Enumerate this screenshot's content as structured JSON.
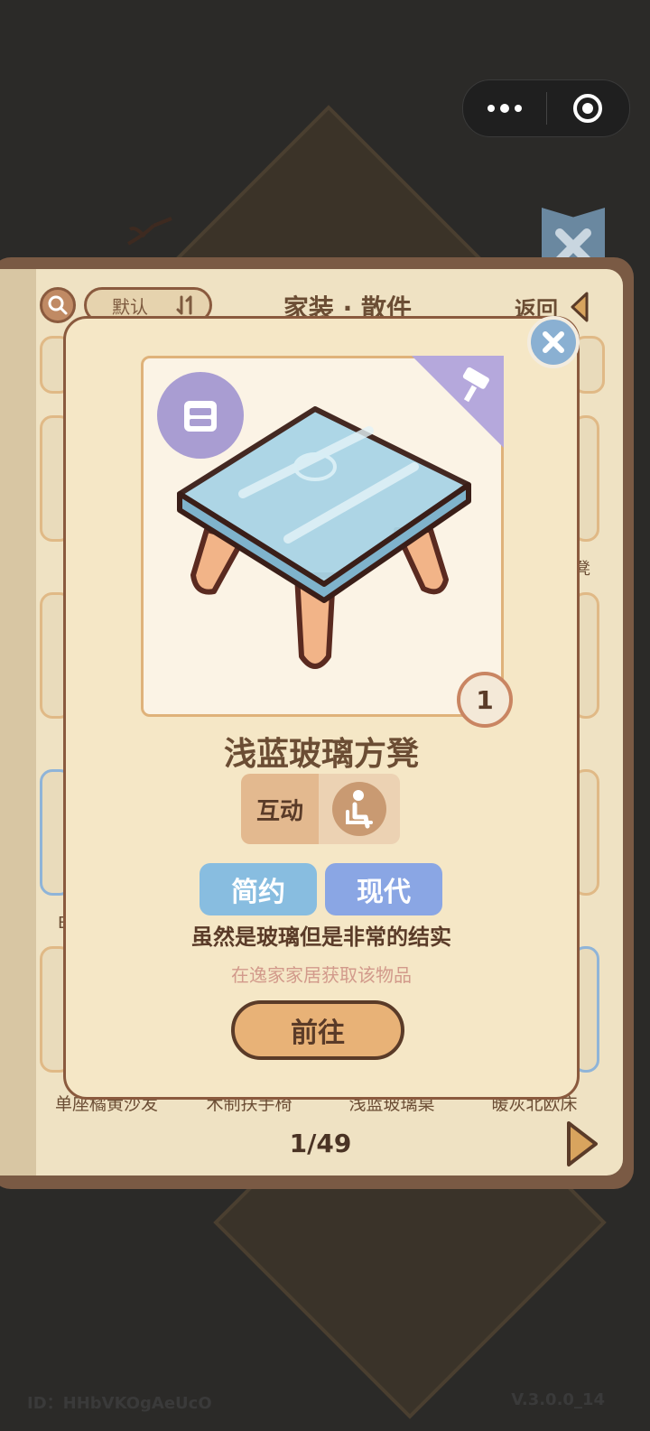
{
  "capsule": {
    "more_icon": "more-dots-icon",
    "close_icon": "target-circle-icon"
  },
  "book": {
    "title": "家装 · 散件",
    "sort_label": "默认",
    "back_label": "返回",
    "page_indicator": "1/49",
    "bottom_items": [
      "单座橘黄沙发",
      "木制扶手椅",
      "浅蓝玻璃桌",
      "暖灰北欧床"
    ],
    "partial_label_right": "凳",
    "partial_label_left": "B"
  },
  "modal": {
    "item_name": "浅蓝玻璃方凳",
    "count": "1",
    "interact_label": "互动",
    "tags": [
      "简约",
      "现代"
    ],
    "description": "虽然是玻璃但是非常的结实",
    "source": "在逸家家居获取该物品",
    "go_button": "前往"
  },
  "footer": {
    "id_text": "ID：HHbVKOgAeUcO",
    "version": "V.3.0.0_14"
  },
  "colors": {
    "modal_bg": "#f5e7c6",
    "border_brown": "#8a5a3e",
    "tag_blue": "#88bde0",
    "tag_periwinkle": "#8aa6e4",
    "badge_purple": "#a99dd2"
  }
}
